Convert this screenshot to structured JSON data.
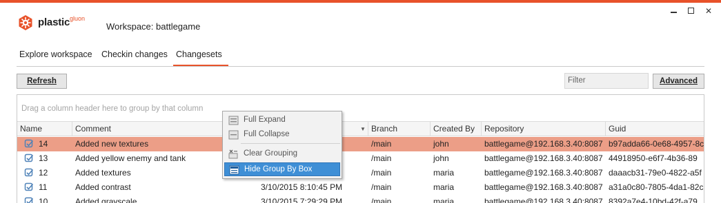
{
  "window": {
    "minimize_glyph": "",
    "maximize_glyph": "",
    "close_glyph": "✕"
  },
  "header": {
    "brand": "plastic",
    "brand_sub": "gluon",
    "workspace_title": "Workspace: battlegame",
    "accent_color": "#e8522a"
  },
  "tabs": [
    {
      "label": "Explore workspace"
    },
    {
      "label": "Checkin changes"
    },
    {
      "label": "Changesets",
      "active": true
    }
  ],
  "toolbar": {
    "refresh_label": "Refresh",
    "filter_placeholder": "Filter",
    "advanced_label": "Advanced"
  },
  "grid": {
    "group_hint": "Drag a column header here to group by that column",
    "columns": [
      "Name",
      "Comment",
      "",
      "Branch",
      "Created By",
      "Repository",
      "Guid"
    ],
    "rows": [
      {
        "name": "14",
        "comment": "Added new textures",
        "date": "",
        "branch": "/main",
        "created_by": "john",
        "repository": "battlegame@192.168.3.40:8087",
        "guid": "b97adda66-0e68-4957-8c",
        "selected": true
      },
      {
        "name": "13",
        "comment": "Added yellow enemy and tank",
        "date": "",
        "branch": "/main",
        "created_by": "john",
        "repository": "battlegame@192.168.3.40:8087",
        "guid": "44918950-e6f7-4b36-89"
      },
      {
        "name": "12",
        "comment": "Added textures",
        "date": "",
        "branch": "/main",
        "created_by": "maria",
        "repository": "battlegame@192.168.3.40:8087",
        "guid": "daaacb31-79e0-4822-a5f"
      },
      {
        "name": "11",
        "comment": "Added contrast",
        "date": "3/10/2015 8:10:45 PM",
        "branch": "/main",
        "created_by": "maria",
        "repository": "battlegame@192.168.3.40:8087",
        "guid": "a31a0c80-7805-4da1-82c"
      },
      {
        "name": "10",
        "comment": "Added grayscale",
        "date": "3/10/2015 7:29:29 PM",
        "branch": "/main",
        "created_by": "maria",
        "repository": "battlegame@192.168.3.40:8087",
        "guid": "8392a7e4-10bd-42f-a79"
      }
    ]
  },
  "context_menu": {
    "items": [
      {
        "label": "Full Expand",
        "icon": "expand-icon"
      },
      {
        "label": "Full Collapse",
        "icon": "collapse-icon"
      },
      {
        "label": "Clear Grouping",
        "icon": "clear-grouping-icon"
      },
      {
        "label": "Hide Group By Box",
        "icon": "hide-group-box-icon",
        "highlighted": true
      }
    ]
  }
}
